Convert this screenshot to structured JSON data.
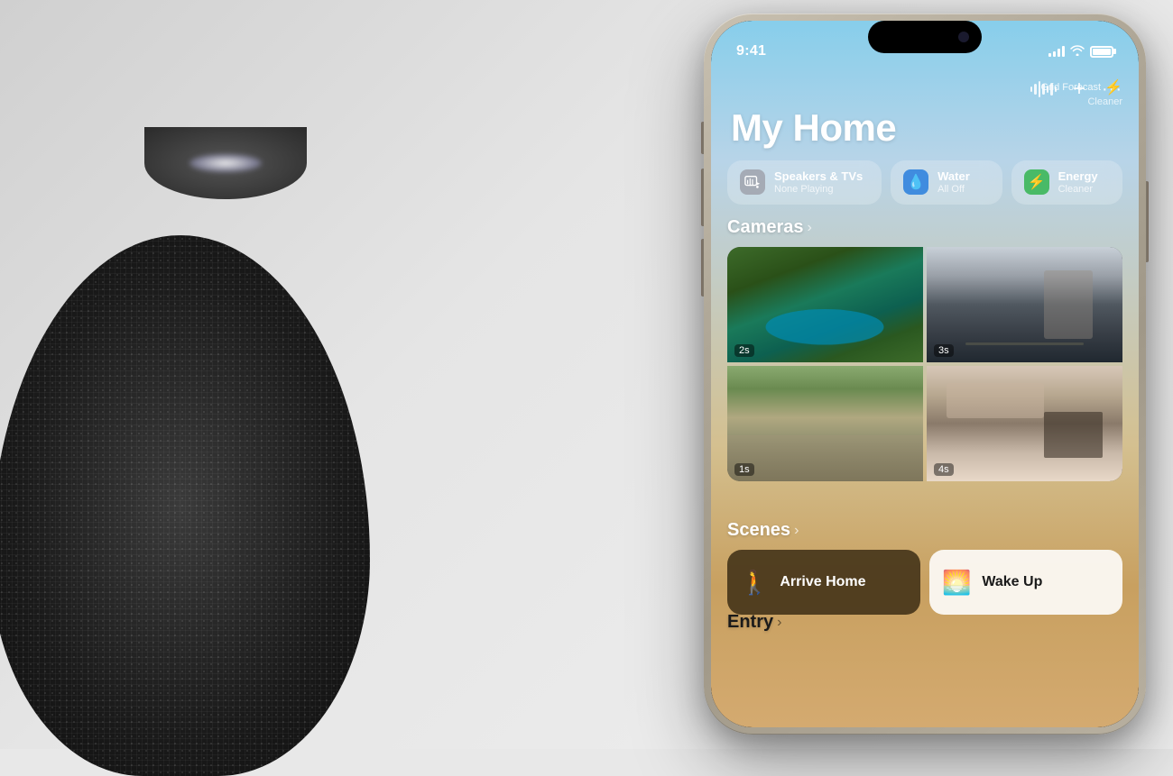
{
  "background": {
    "color": "#e0ddd8"
  },
  "statusBar": {
    "time": "9:41",
    "signal": "full",
    "wifi": true,
    "battery": "full"
  },
  "topActions": {
    "soundwave_label": "sound-wave-icon",
    "add_label": "+",
    "more_label": "···"
  },
  "gridForecast": {
    "line1": "Grid Forecast",
    "line2": "Cleaner"
  },
  "title": "My Home",
  "chips": [
    {
      "id": "speakers",
      "icon": "🖥",
      "iconColor": "gray",
      "title": "Speakers & TVs",
      "sub": "None Playing"
    },
    {
      "id": "water",
      "icon": "💧",
      "iconColor": "blue",
      "title": "Water",
      "sub": "All Off"
    },
    {
      "id": "energy",
      "icon": "⚡",
      "iconColor": "green",
      "title": "Energy",
      "sub": "Cleaner"
    }
  ],
  "cameras": {
    "sectionTitle": "Cameras",
    "feeds": [
      {
        "id": "pool",
        "timestamp": "2s",
        "position": "top-left"
      },
      {
        "id": "gym",
        "timestamp": "3s",
        "position": "top-right"
      },
      {
        "id": "patio",
        "timestamp": "1s",
        "position": "bottom-left"
      },
      {
        "id": "living",
        "timestamp": "4s",
        "position": "bottom-right"
      }
    ]
  },
  "scenes": {
    "sectionTitle": "Scenes",
    "items": [
      {
        "id": "arrive-home",
        "icon": "🚶",
        "label": "Arrive Home",
        "style": "dark"
      },
      {
        "id": "wake-up",
        "icon": "🌅",
        "label": "Wake Up",
        "style": "light"
      }
    ]
  },
  "entry": {
    "sectionTitle": "Entry"
  }
}
